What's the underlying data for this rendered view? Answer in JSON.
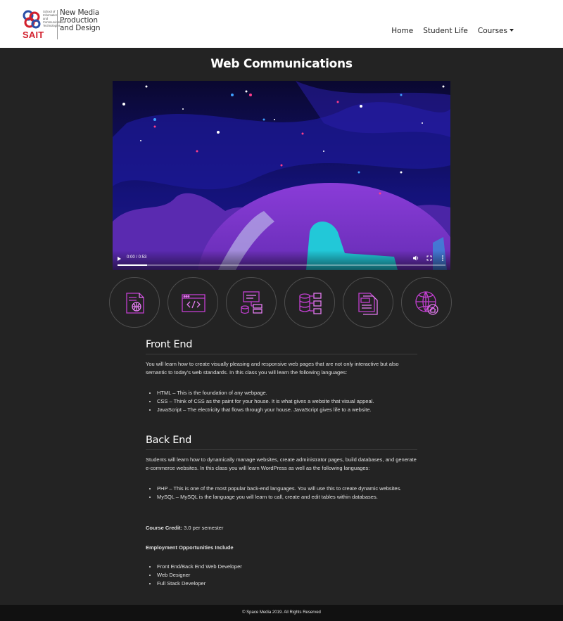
{
  "header": {
    "logo": {
      "brand": "SAIT",
      "school": "School of Information and Communications Technologies",
      "program_line1": "New Media",
      "program_line2": "Production",
      "program_line3": "and Design"
    },
    "nav": [
      {
        "label": "Home"
      },
      {
        "label": "Student Life"
      },
      {
        "label": "Courses"
      }
    ]
  },
  "page": {
    "title": "Web Communications"
  },
  "video": {
    "time": "0:00 / 0:53",
    "progress": 0.09,
    "colors": {
      "sky": "#0d0a3a",
      "nebula": "#3a1fa8",
      "planet": "#7b2fd4",
      "accent": "#22c8d8"
    }
  },
  "icons": [
    {
      "name": "web-document-icon"
    },
    {
      "name": "code-window-icon"
    },
    {
      "name": "server-database-icon"
    },
    {
      "name": "database-stack-icon"
    },
    {
      "name": "php-file-icon"
    },
    {
      "name": "globe-home-icon"
    }
  ],
  "front_end": {
    "heading": "Front End",
    "intro": "You will learn how to create visually pleasing and responsive web pages that are not only interactive but also semantic to today's web standards. In this class you will learn the following languages:",
    "items": [
      "HTML – This is the foundation of any webpage.",
      "CSS – Think of CSS as the paint for your house. It is what gives a website that visual appeal.",
      "JavaScript – The electricity that flows through your house. JavaScript gives life to a website."
    ]
  },
  "back_end": {
    "heading": "Back End",
    "intro": "Students will learn how to dynamically manage websites, create administrator pages, build databases, and generate e-commerce websites. In this class you will learn WordPress as well as the following languages:",
    "items": [
      "PHP – This is one of the most popular back-end languages. You will use this to create dynamic websites.",
      "MySQL – MySQL is the language you will learn to call, create and edit tables within databases."
    ]
  },
  "course_credit": {
    "label": "Course Credit:",
    "value": " 3.0 per semester"
  },
  "employment": {
    "heading": "Employment Opportunities Include",
    "items": [
      "Front End/Back End Web Developer",
      "Web Designer",
      "Full Stack Developer"
    ]
  },
  "footer": {
    "text": "© Space Media 2019. All Rights Reserved"
  },
  "colors": {
    "background": "#232323",
    "header_bg": "#ffffff",
    "footer_bg": "#111111",
    "icon_stroke": "#c13fd0",
    "brand_red": "#d21f2c"
  }
}
